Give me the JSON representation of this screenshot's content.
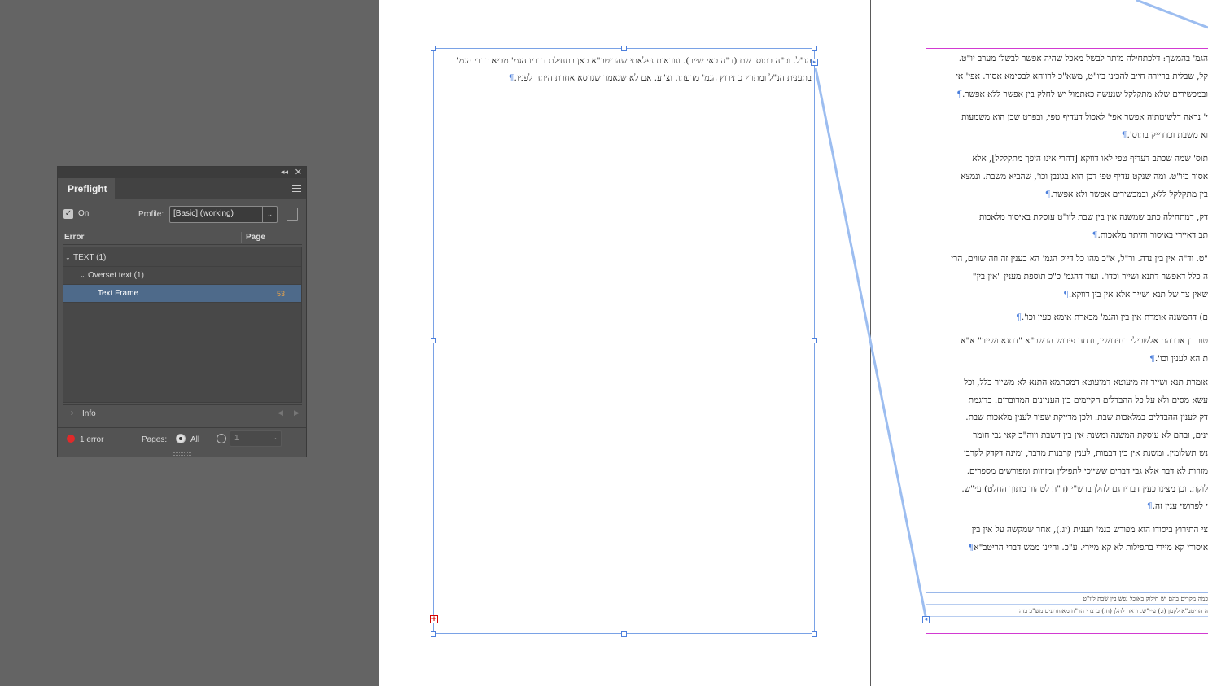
{
  "colors": {
    "pasteboard": "#646464",
    "page": "#ffffff",
    "frame_border": "#7aa2e6",
    "margin_guide": "#d23ad2",
    "overset_marker": "#d40000",
    "error_dot": "#e02a2a",
    "selected_row": "#4e6a8a",
    "page_number": "#e8a34a"
  },
  "document": {
    "left_frame_lines": [
      "הנ\"ל. וכ\"ה בתוס' שם (ד\"ה כאי שייר). ונוראות נפלאתי שהריטב\"א כאן בתחילת דבריו הגמ' מביא דברי הגמ'",
      "בתענית הנ\"ל ומתרץ כתירוץ הגמ' מדעתו. וצ\"ע. אם לא שנאמר שגרסא אחרת היתה לפניו."
    ],
    "left_frame_pilcrow": "¶",
    "out_port_icon": "thread-out-port-icon",
    "overset_symbol": "+",
    "right_paragraphs": [
      [
        "הגמ' בהמשך: דלכתחילה מותר לבשל מאכל שהיה אפשר לבשלו מערב יו\"ט.",
        "קל, שבלית בריירה חייב להכינו ביו\"ט, משא\"כ לרווחא לבסימא אסור. אפי' אי",
        "ובמכשירים שלא מתקלקל שנעשה כאתמול יש לחלק בין אפשר ללא אפשר."
      ],
      [
        "י' נראה דלשיטתיה אפשר אפי' לאכול דעדיף טפי, ובפרט שכן הוא משמעות",
        "וא משבת וכדדייק בתוס'."
      ],
      [
        "תוס' שמה שכתב דעדיף טפי לאו דווקא [דהרי אינו היפך מתקלקל], אלא",
        "אסור ביו\"ט. ומה שנקט עדיף טפי דכן הוא בגונבן וכו', שהביא משבת. ונמצא",
        "בין מתקלקל ללא, ובמכשירים אפשר ולא אפשר."
      ],
      [
        "דק, דמתחילה כתב שמשנה אין בין שבת ליו\"ט עוסקת באיסור מלאכות",
        "תב דאיירי באיסור והיתר מלאכות."
      ],
      [
        "\"ט. וד\"ה אין בין נדה. ור\"ל, א\"כ מהו כל דיוק הגמ' הא בענין זה וזה שווים, הרי",
        "ה כלל דאפשר דתנא ושייר וכדו'. ועוד דהגמ' כ\"כ תוספת מענין \"אין בין\"",
        "שאין צד של תנא ושייר אלא אין בין דווקא."
      ],
      [
        "ם) דהמשנה אומרת אין בין והגמ' מבארת אימא כעין וכו'."
      ],
      [
        "טוב בן אברהם אלשבילי בחידושיו, ודחה פירוש הרשב\"א \"דתנא ושייר\" א\"א",
        "ת הא לענין וכו'."
      ],
      [
        "אומרת תנא ושייר זה מיעוטא דמיעוטא דמסתמא התנא לא משייר כלל, וכל",
        "עשא מסים ולא על כל ההבדלים הקיימים בין העניינים המדוברים. כדוגמת",
        "דק לענין ההבדלים במלאכות שבת. ולכן מדייקת שפיר לענין מלאכות שבת.",
        "ינים, ובהם לא עוסקת המשנה ומשנת אין בין דשבת ויוה\"כ קאי גבי חומר",
        "נש תשלומין. ומשנת אין בין דבמות, לענין קרבנות מדבר, ומינה דקדק לקרבן",
        "מזוזות לא דבר אלא גבי דברים ששייכי לתפילין ומזוזות ומפורשים מספרים.",
        "לוקת. וכן מצינו כעין דבריו גם להלן ברש\"י (ד\"ה לטהור מתוך החלט) עי\"ש.",
        "י לפרושי ענין זה."
      ],
      [
        "צי התירוץ ביסודו הוא מפורש בגמ' תענית (יג.), אחר שמקשה על אין בין",
        "איסורי קא מיירי בתפילות לא קא מיירי. ע\"כ. והיינו ממש דברי הריטב\"א"
      ]
    ],
    "footnote_lines": [
      "כמה מקרים בהם יש חילוק באוכל נפש בין שבת ליו\"ט",
      "",
      "ה הריטב\"א לקמן (ו.) עיי\"ש. וראה להלן (ח.) בדברי הר\"ח מאוחרונים מש\"כ בזה"
    ],
    "in_port_icon": "thread-in-port-icon"
  },
  "preflight": {
    "title": "Preflight",
    "collapse_icon": "double-chevron-icon",
    "close_icon": "close-icon",
    "on_checked": true,
    "on_label": "On",
    "profile_label": "Profile:",
    "profile_value": "[Basic] (working)",
    "columns": {
      "error": "Error",
      "page": "Page"
    },
    "tree": [
      {
        "label": "TEXT (1)",
        "level": 0,
        "expanded": true
      },
      {
        "label": "Overset text (1)",
        "level": 1,
        "expanded": true
      },
      {
        "label": "Text Frame",
        "level": 2,
        "page": "53",
        "selected": true
      }
    ],
    "info_label": "Info",
    "error_count": "1 error",
    "pages_label": "Pages:",
    "all_label": "All",
    "range_value": "1"
  }
}
